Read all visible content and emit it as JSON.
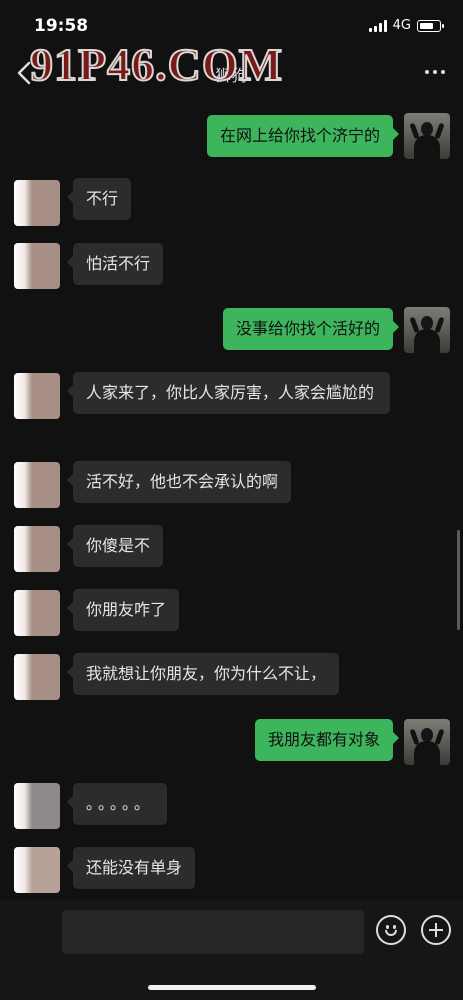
{
  "status": {
    "time": "19:58",
    "network": "4G",
    "battery_level": 0.7
  },
  "nav": {
    "title": "狮狗"
  },
  "watermark": {
    "text": "91P46.COM"
  },
  "messages": [
    {
      "side": "out",
      "text": "在网上给你找个济宁的"
    },
    {
      "side": "in",
      "text": "不行"
    },
    {
      "side": "in",
      "text": "怕活不行"
    },
    {
      "side": "out",
      "text": "没事给你找个活好的"
    },
    {
      "side": "in",
      "text": "人家来了，你比人家厉害，人家会尴尬的"
    },
    {
      "side": "in",
      "text": "活不好，他也不会承认的啊"
    },
    {
      "side": "in",
      "text": "你傻是不"
    },
    {
      "side": "in",
      "text": "你朋友咋了"
    },
    {
      "side": "in",
      "text": "我就想让你朋友，你为什么不让，"
    },
    {
      "side": "out",
      "text": "我朋友都有对象"
    },
    {
      "side": "in",
      "text": "。。。。。"
    },
    {
      "side": "in",
      "text": "还能没有单身"
    }
  ],
  "icons": {
    "back": "chevron-left-icon",
    "more": "more-dots-icon",
    "emoji": "emoji-icon",
    "add": "plus-icon"
  },
  "colors": {
    "background": "#111111",
    "bubble_out": "#3db55d",
    "bubble_in": "#2c2c2c"
  }
}
